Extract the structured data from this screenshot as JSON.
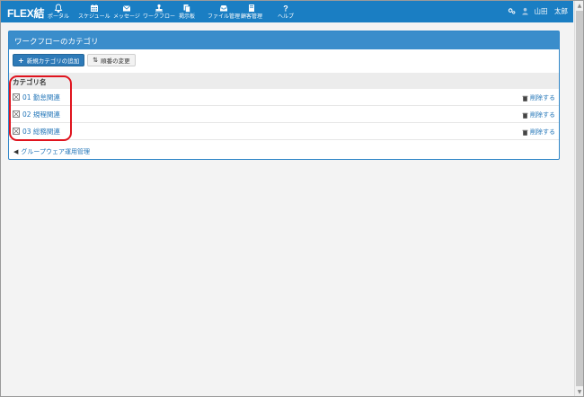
{
  "brand": "FLEX結",
  "nav": {
    "items": [
      {
        "label": "ポータル",
        "icon": "bell-icon"
      },
      {
        "label": "スケジュール",
        "icon": "calendar-icon"
      },
      {
        "label": "メッセージ",
        "icon": "envelope-icon"
      },
      {
        "label": "ワークフロー",
        "icon": "stamp-icon"
      },
      {
        "label": "掲示板",
        "icon": "documents-icon"
      },
      {
        "label": "ファイル管理",
        "icon": "inbox-icon"
      },
      {
        "label": "顧客管理",
        "icon": "book-icon"
      },
      {
        "label": "ヘルプ",
        "icon": "question-icon"
      }
    ],
    "user_name": "山田　太郎"
  },
  "panel": {
    "title": "ワークフローのカテゴリ",
    "add_button": "新規カテゴリの追加",
    "order_button": "順番の変更",
    "column_header": "カテゴリ名",
    "rows": [
      {
        "label": "01 勤怠関連",
        "delete": "削除する"
      },
      {
        "label": "02 規程関連",
        "delete": "削除する"
      },
      {
        "label": "03 総務関連",
        "delete": "削除する"
      }
    ],
    "back_link": "グループウェア運用管理"
  },
  "colors": {
    "nav_bg": "#1a7ec3",
    "panel_header": "#3a8dcb",
    "link": "#1f73b7",
    "highlight": "#e0141e"
  }
}
